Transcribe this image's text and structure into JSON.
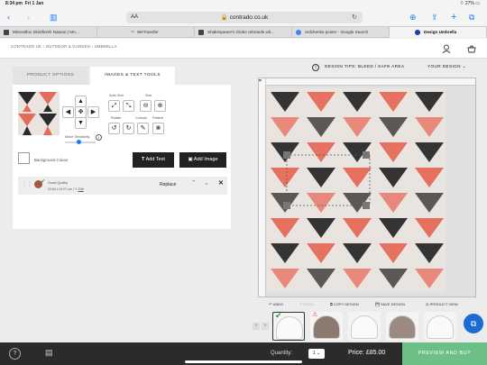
{
  "status": {
    "time": "8:34 pm",
    "date": "Fri 1 Jan",
    "battery": "27%"
  },
  "browser": {
    "url": "contrado.co.uk",
    "aa": "AA",
    "tabs": [
      {
        "label": "Mineralfox Skintfinish Natural | MA..."
      },
      {
        "label": "WeTransfer"
      },
      {
        "label": "Shakespeare's Globe rebrands wit..."
      },
      {
        "label": "redchenko poster - Google Search"
      },
      {
        "label": "Design Umbrella"
      }
    ]
  },
  "site": {
    "breadcrumb": "CONTRADO UK   ›   OUTDOOR & GARDEN   ›   UMBRELLA"
  },
  "panel_tabs": {
    "product_options": "PRODUCT OPTIONS",
    "images_text": "IMAGES & TEXT TOOLS"
  },
  "tools": {
    "auto_size": "Auto Size",
    "size": "Size",
    "rotate": "Rotate",
    "colours": "Colours",
    "pattern": "Pattern",
    "move_sensitivity": "Move Sensitivity",
    "background_colour": "Background Colour",
    "add_text": "Add Text",
    "add_image": "Add Image"
  },
  "layer": {
    "quality": "Good Quality",
    "dims": "23.64 x 19.07 cm |",
    "edit": "Edit",
    "replace": "Replace"
  },
  "design_bar": {
    "tips": "DESIGN TIPS: BLEED / SAFE AREA",
    "your_design": "YOUR DESIGN"
  },
  "toolbar": {
    "undo": "UNDO",
    "redo": "REDO",
    "copy": "COPY DESIGN",
    "save": "SAVE DESIGN",
    "view": "PRODUCT VIEW"
  },
  "footer": {
    "quantity_label": "Quantity:",
    "quantity": "1",
    "price": "Price: £85.00",
    "buy": "PREVIEW AND BUY"
  },
  "colors": {
    "accent": "#1a7cf5",
    "buy": "#6bbf87",
    "footer": "#2b2b2b",
    "pattern_red": "#e66a5a",
    "pattern_dark": "#2a2a2a"
  }
}
